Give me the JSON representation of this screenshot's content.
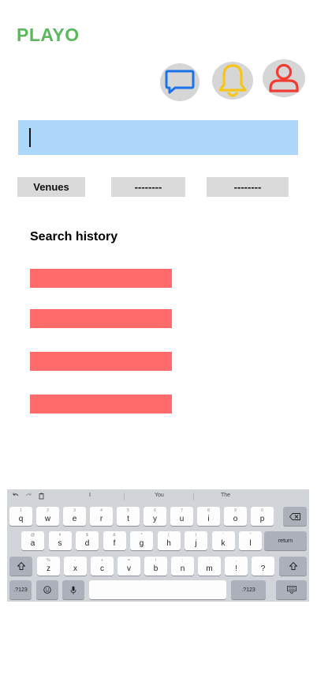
{
  "app": {
    "brand": "PLAYO",
    "brand_color": "#5cb85c"
  },
  "header_icons": [
    {
      "name": "chat-icon",
      "color": "#1a73e8"
    },
    {
      "name": "bell-icon",
      "color": "#f5c518"
    },
    {
      "name": "user-icon",
      "color": "#f03c32"
    }
  ],
  "search": {
    "value": "",
    "background": "#acd7fb"
  },
  "filters": [
    {
      "label": "Venues"
    },
    {
      "label": "--------"
    },
    {
      "label": "--------"
    }
  ],
  "history": {
    "title": "Search history",
    "items": [
      "",
      "",
      "",
      ""
    ],
    "item_color": "#ff6b6b"
  },
  "keyboard": {
    "suggestions": [
      "I",
      "You",
      "The"
    ],
    "row1": [
      {
        "k": "q",
        "s": "1"
      },
      {
        "k": "w",
        "s": "2"
      },
      {
        "k": "e",
        "s": "3"
      },
      {
        "k": "r",
        "s": "4"
      },
      {
        "k": "t",
        "s": "5"
      },
      {
        "k": "y",
        "s": "6"
      },
      {
        "k": "u",
        "s": "7"
      },
      {
        "k": "i",
        "s": "8"
      },
      {
        "k": "o",
        "s": "9"
      },
      {
        "k": "p",
        "s": "0"
      }
    ],
    "row2": [
      {
        "k": "a",
        "s": "@"
      },
      {
        "k": "s",
        "s": "#"
      },
      {
        "k": "d",
        "s": "$"
      },
      {
        "k": "f",
        "s": "&"
      },
      {
        "k": "g",
        "s": "*"
      },
      {
        "k": "h",
        "s": "("
      },
      {
        "k": "j",
        "s": ")"
      },
      {
        "k": "k",
        "s": "'"
      },
      {
        "k": "l",
        "s": "\""
      }
    ],
    "row3": [
      {
        "k": "z",
        "s": "%"
      },
      {
        "k": "x",
        "s": "-"
      },
      {
        "k": "c",
        "s": "+"
      },
      {
        "k": "v",
        "s": "="
      },
      {
        "k": "b",
        "s": "/"
      },
      {
        "k": "n",
        "s": ";"
      },
      {
        "k": "m",
        "s": ":"
      },
      {
        "k": "!",
        "s": ","
      },
      {
        "k": "?",
        "s": "."
      }
    ],
    "return_label": "return",
    "numbers_label": ".?123"
  }
}
